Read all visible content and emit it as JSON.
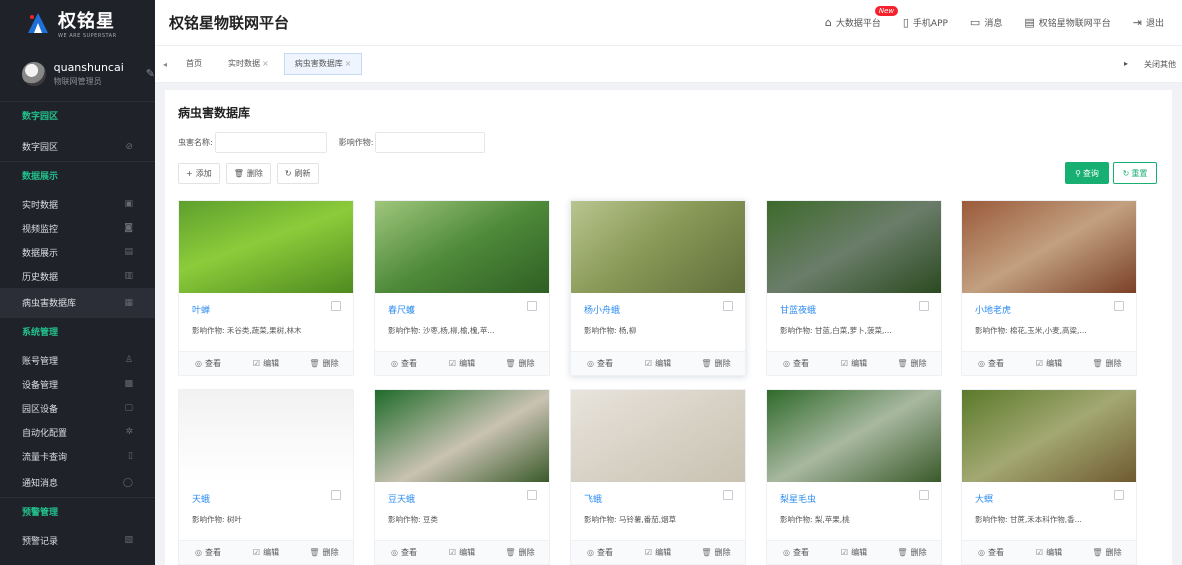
{
  "brand": {
    "name": "权铭星",
    "tagline": "WE ARE SUPERSTAR"
  },
  "user": {
    "name": "quanshuncai",
    "role": "物联网管理员"
  },
  "sidebar": {
    "sections": [
      {
        "title": "数字园区",
        "items": [
          {
            "label": "数字园区",
            "icon": "compass-icon"
          }
        ]
      },
      {
        "title": "数据展示",
        "items": [
          {
            "label": "实时数据",
            "icon": "monitor-icon"
          },
          {
            "label": "视频监控",
            "icon": "camera-icon"
          },
          {
            "label": "数据展示",
            "icon": "grid-icon"
          },
          {
            "label": "历史数据",
            "icon": "history-icon"
          },
          {
            "label": "病虫害数据库",
            "icon": "doc-icon"
          }
        ]
      },
      {
        "title": "系统管理",
        "items": [
          {
            "label": "账号管理",
            "icon": "user-icon"
          },
          {
            "label": "设备管理",
            "icon": "device-icon"
          },
          {
            "label": "园区设备",
            "icon": "box-icon"
          },
          {
            "label": "自动化配置",
            "icon": "gear-icon"
          },
          {
            "label": "流量卡查询",
            "icon": "card-icon"
          },
          {
            "label": "通知消息",
            "icon": "bell-icon"
          }
        ]
      },
      {
        "title": "预警管理",
        "items": [
          {
            "label": "预警记录",
            "icon": "warning-icon"
          }
        ]
      }
    ]
  },
  "header": {
    "title": "权铭星物联网平台",
    "bigdata": "大数据平台",
    "new_badge": "New",
    "app": "手机APP",
    "msg": "消息",
    "platform": "权铭星物联网平台",
    "logout": "退出"
  },
  "tabs": {
    "items": [
      {
        "label": "首页",
        "closable": false
      },
      {
        "label": "实时数据",
        "closable": true
      },
      {
        "label": "病虫害数据库",
        "closable": true,
        "active": true
      }
    ],
    "close_others": "关闭其他"
  },
  "page": {
    "title": "病虫害数据库",
    "filter_name_label": "虫害名称:",
    "filter_crop_label": "影响作物:",
    "add": "添加",
    "delete": "删除",
    "refresh": "刷新",
    "query": "查询",
    "reset": "重置"
  },
  "card_labels": {
    "affect_prefix": "影响作物:",
    "view": "查看",
    "edit": "编辑",
    "delete": "删除"
  },
  "pests": [
    {
      "name": "叶蝉",
      "crops": "禾谷类,蔬菜,果树,林木"
    },
    {
      "name": "春尺蠖",
      "crops": "沙枣,杨,柳,榆,槐,苹..."
    },
    {
      "name": "杨小舟蛾",
      "crops": "杨,柳"
    },
    {
      "name": "甘蓝夜蛾",
      "crops": "甘蓝,白菜,萝卜,菠菜,..."
    },
    {
      "name": "小地老虎",
      "crops": "棉花,玉米,小麦,高粱,..."
    },
    {
      "name": "天蛾",
      "crops": "树叶"
    },
    {
      "name": "豆天蛾",
      "crops": "豆类"
    },
    {
      "name": "飞蛾",
      "crops": "马铃薯,番茄,烟草"
    },
    {
      "name": "梨星毛虫",
      "crops": "梨,苹果,桃"
    },
    {
      "name": "大螟",
      "crops": "甘蔗,禾本科作物,香..."
    }
  ],
  "colors": {
    "sidebar_bg": "#20222a",
    "section_green": "#22c08b",
    "primary": "#18b072",
    "link_blue": "#2d8cf0"
  }
}
